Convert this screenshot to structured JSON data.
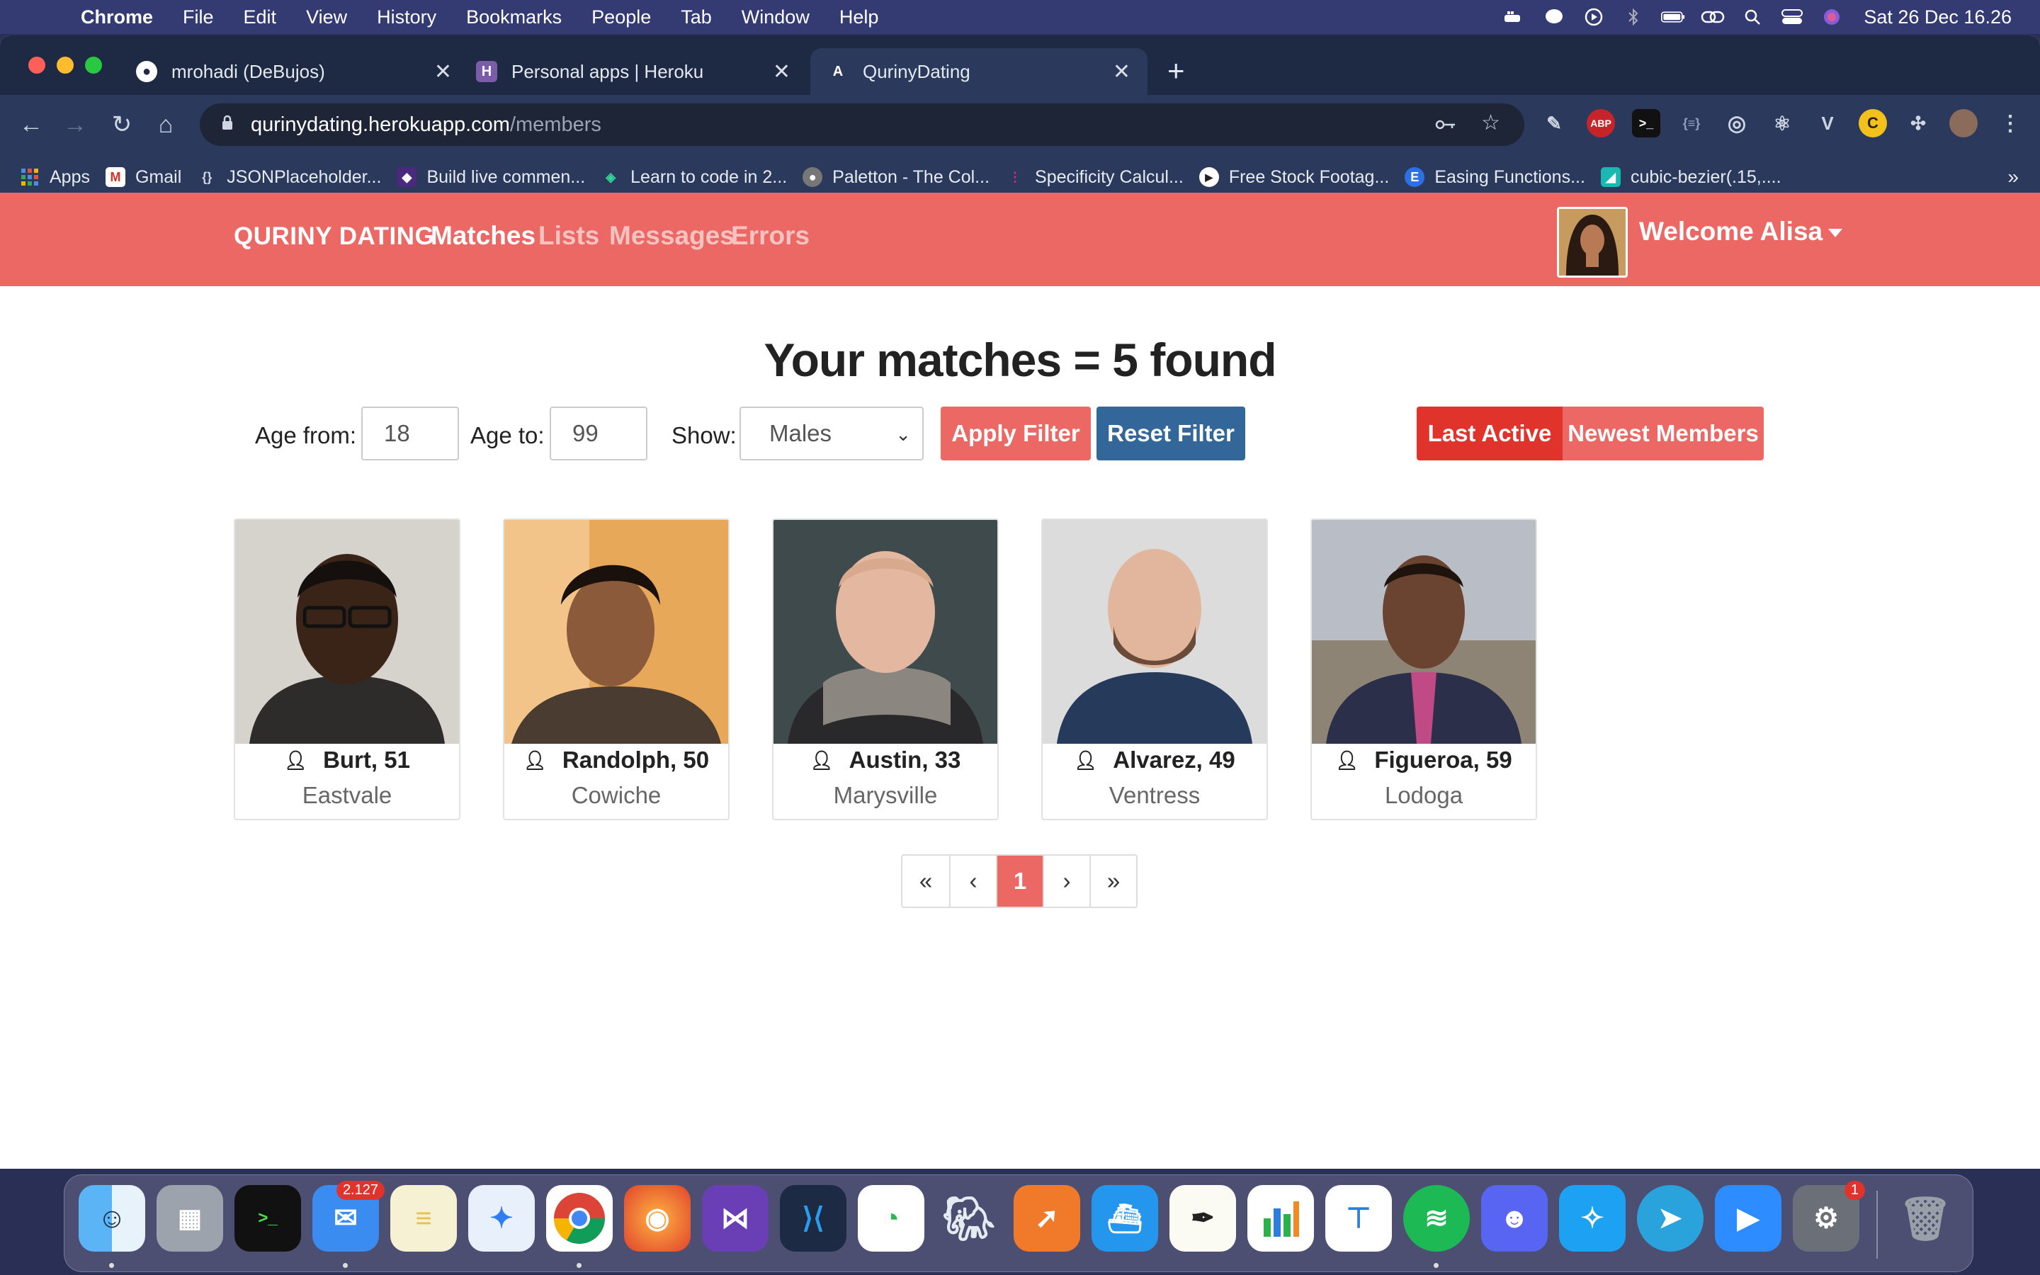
{
  "menubar": {
    "app_name": "Chrome",
    "items": [
      "File",
      "Edit",
      "View",
      "History",
      "Bookmarks",
      "People",
      "Tab",
      "Window",
      "Help"
    ],
    "clock": "Sat 26 Dec  16.26"
  },
  "browser": {
    "tabs": [
      {
        "title": "mrohadi (DeBujos)",
        "icon": "github-icon"
      },
      {
        "title": "Personal apps | Heroku",
        "icon": "heroku-icon"
      },
      {
        "title": "QurinyDating",
        "icon": "app-icon"
      }
    ],
    "url_host": "qurinydating.herokuapp.com",
    "url_path": "/members",
    "bookmarks": [
      "Apps",
      "Gmail",
      "JSONPlaceholder...",
      "Build live commen...",
      "Learn to code in 2...",
      "Paletton - The Col...",
      "Specificity Calcul...",
      "Free Stock Footag...",
      "Easing Functions...",
      "cubic-bezier(.15,...."
    ],
    "bookmarks_more": "»"
  },
  "app": {
    "brand": "QURINY DATING",
    "nav": {
      "matches": "Matches",
      "lists": "Lists",
      "messages": "Messages",
      "errors": "Errors"
    },
    "welcome": "Welcome Alisa",
    "heading": "Your matches = 5 found",
    "filter": {
      "age_from_label": "Age from:",
      "age_from": "18",
      "age_to_label": "Age to:",
      "age_to": "99",
      "show_label": "Show:",
      "show_value": "Males",
      "apply": "Apply Filter",
      "reset": "Reset Filter",
      "last_active": "Last Active",
      "newest": "Newest Members"
    },
    "members": [
      {
        "name": "Burt, 51",
        "city": "Eastvale"
      },
      {
        "name": "Randolph, 50",
        "city": "Cowiche"
      },
      {
        "name": "Austin, 33",
        "city": "Marysville"
      },
      {
        "name": "Alvarez, 49",
        "city": "Ventress"
      },
      {
        "name": "Figueroa, 59",
        "city": "Lodoga"
      }
    ],
    "pagination": {
      "first": "«",
      "prev": "‹",
      "current": "1",
      "next": "›",
      "last": "»"
    }
  },
  "dock": {
    "mail_badge": "2.127",
    "settings_badge": "1"
  },
  "colors": {
    "brand": "#eb6864",
    "blue": "#336699",
    "active_red": "#e0332c"
  }
}
